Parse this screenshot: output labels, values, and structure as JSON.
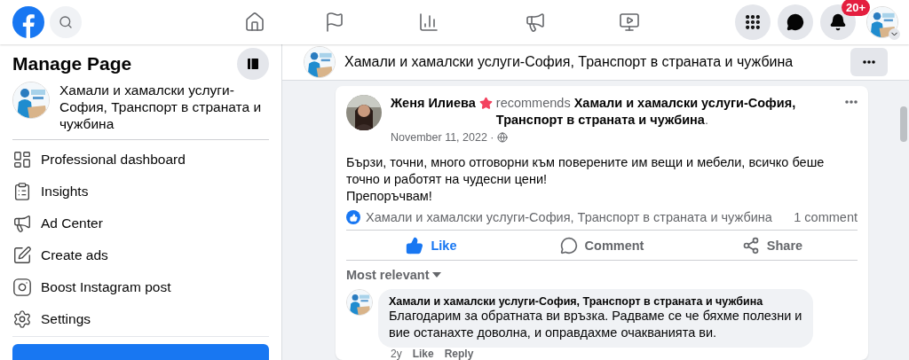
{
  "top_bar": {
    "notifications_badge": "20+",
    "nav": [
      {
        "kind": "home",
        "selected": false
      },
      {
        "kind": "flag",
        "selected": false
      },
      {
        "kind": "chart",
        "selected": false
      },
      {
        "kind": "megaphone",
        "selected": false
      },
      {
        "kind": "video",
        "selected": false
      }
    ]
  },
  "sidebar": {
    "title": "Manage Page",
    "page_name": "Хамали и хамалски услуги-София, Транспорт в страната и чужбина",
    "items": [
      {
        "kind": "dashboard",
        "label": "Professional dashboard"
      },
      {
        "kind": "insights",
        "label": "Insights"
      },
      {
        "kind": "adcenter",
        "label": "Ad Center"
      },
      {
        "kind": "createads",
        "label": "Create ads"
      },
      {
        "kind": "instagram",
        "label": "Boost Instagram post"
      },
      {
        "kind": "settings",
        "label": "Settings"
      }
    ]
  },
  "page_header": {
    "title": "Хамали и хамалски услуги-София, Транспорт в страната и чужбина"
  },
  "post": {
    "author": "Женя Илиева",
    "recommendation": "recommends **Хамали и хамалски услуги-София, Транспорт в страната и чужбина**.",
    "date": "November 11, 2022 ·",
    "text": "Бързи, точни, много отговорни към поверените им вещи и мебели, всичко беше точно и работят на чудесни цени!\nПрепоръчвам!",
    "liked_by": "Хамали и хамалски услуги-София, Транспорт в страната и чужбина",
    "comment_count": "1 comment",
    "actions": [
      {
        "kind": "like",
        "label": "Like",
        "selected": true
      },
      {
        "kind": "comment",
        "label": "Comment",
        "selected": false
      },
      {
        "kind": "share",
        "label": "Share",
        "selected": false
      }
    ],
    "sort": "Most relevant",
    "comments": [
      {
        "author": "Хамали и хамалски услуги-София, Транспорт в страната и чужбина",
        "text": "Благодарим за обратната ви връзка. Радваме се че бяхме полезни и вие останахте доволна, и оправдахме очакванията ви.",
        "time": "2y",
        "like": "Like",
        "reply": "Reply"
      }
    ]
  }
}
